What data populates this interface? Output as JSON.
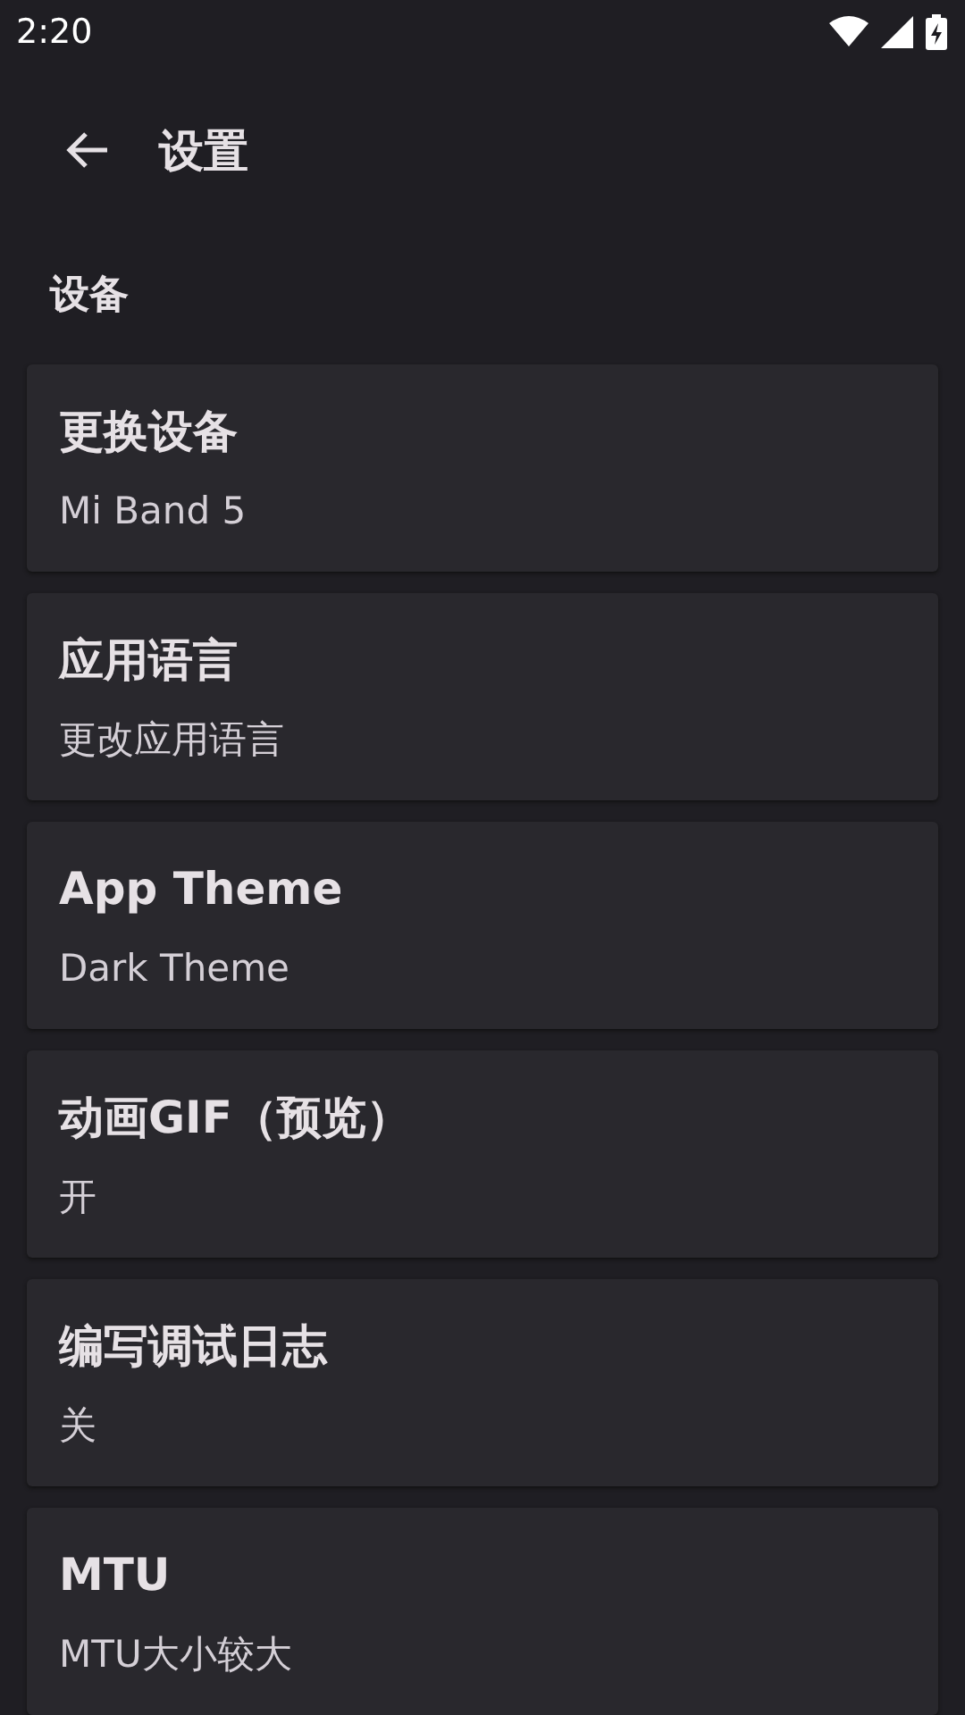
{
  "status_bar": {
    "time": "2:20"
  },
  "header": {
    "title": "设置"
  },
  "section": {
    "title": "设备"
  },
  "settings": [
    {
      "title": "更换设备",
      "value": "Mi Band 5"
    },
    {
      "title": "应用语言",
      "value": "更改应用语言"
    },
    {
      "title": "App Theme",
      "value": "Dark Theme"
    },
    {
      "title": "动画GIF（预览）",
      "value": "开"
    },
    {
      "title": "编写调试日志",
      "value": "关"
    },
    {
      "title": "MTU",
      "value": "MTU大小较大"
    }
  ]
}
